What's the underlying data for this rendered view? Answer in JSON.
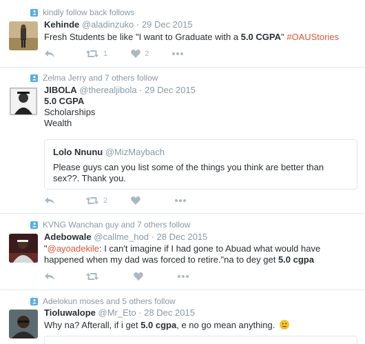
{
  "tweets": [
    {
      "context": "kindly follow back follows",
      "name": "Kehinde",
      "handle": "@aladinzuko",
      "sep": "·",
      "date": "29 Dec 2015",
      "text_prefix": "Fresh Students be like \"I want to Graduate with a ",
      "text_bold": "5.0 CGPA",
      "text_suffix": "\" ",
      "hashtag": "#OAUStories",
      "retweets": "1",
      "likes": "2"
    },
    {
      "context": "Zelma Jerry and 7 others follow",
      "name": "JIBOLA",
      "handle": "@therealjibola",
      "sep": "·",
      "date": "29 Dec 2015",
      "line1": "5.0 CGPA",
      "line2": "Scholarships",
      "line3": "Wealth",
      "quote_name": "Lolo Nnunu",
      "quote_handle": "@MizMaybach",
      "quote_text": "Please guys can you list some of the things you think are better than sex??. Thank you.",
      "retweets": "2",
      "likes": ""
    },
    {
      "context": "KVNG Wanchan guy and 7 others follow",
      "name": "Adebowale",
      "handle": "@callme_hod",
      "sep": "·",
      "date": "28 Dec 2015",
      "quote_open": "\"",
      "mention": "@ayoadekile",
      "text_mid": ": I can't imagine if I had gone to Abuad what would have happened when my dad was forced to retire.\"na to dey get ",
      "text_bold": "5.0 cgpa"
    },
    {
      "context": "Adelokun moses and 5 others follow",
      "name": "Tioluwalope",
      "handle": "@Mr_Eto",
      "sep": "·",
      "date": "28 Dec 2015",
      "text_prefix": "Why na? Afterall, if i get ",
      "text_bold": "5.0 cgpa",
      "text_suffix": ", e no go mean anything. "
    }
  ]
}
